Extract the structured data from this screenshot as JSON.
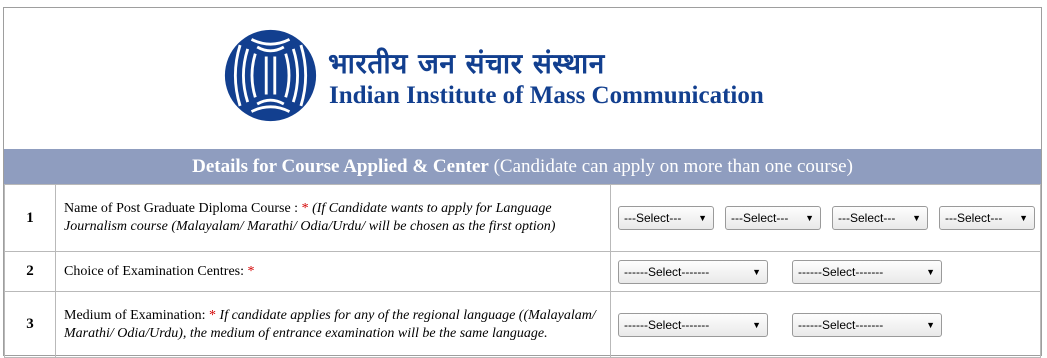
{
  "header": {
    "logo": "iimc-logo-icon",
    "name_hindi": "भारतीय जन संचार संस्थान",
    "name_english": "Indian Institute of Mass Communication",
    "brand_color": "#123f8f"
  },
  "banner": {
    "title": "Details for Course Applied & Center",
    "subtitle": " (Candidate can apply on more than one course)",
    "bg_color": "#8f9dbf"
  },
  "rows": [
    {
      "num": "1",
      "label": "Name of Post Graduate Diploma Course : ",
      "required": "*",
      "note": " (If Candidate wants to apply for Language Journalism course (Malayalam/ Marathi/ Odia/Urdu/ will be chosen as the first option)",
      "selects": [
        "---Select---",
        "---Select---",
        "---Select---",
        "---Select---"
      ]
    },
    {
      "num": "2",
      "label": "Choice of Examination Centres: ",
      "required": "*",
      "selects": [
        "------Select-------",
        "------Select-------"
      ]
    },
    {
      "num": "3",
      "label": "Medium of Examination: ",
      "required": "*",
      "note": " If candidate applies for any of the regional language ((Malayalam/ Marathi/ Odia/Urdu), the medium of entrance examination will be the same language.",
      "selects": [
        "------Select-------",
        "------Select-------"
      ]
    }
  ],
  "dropdown_arrow": "▼"
}
